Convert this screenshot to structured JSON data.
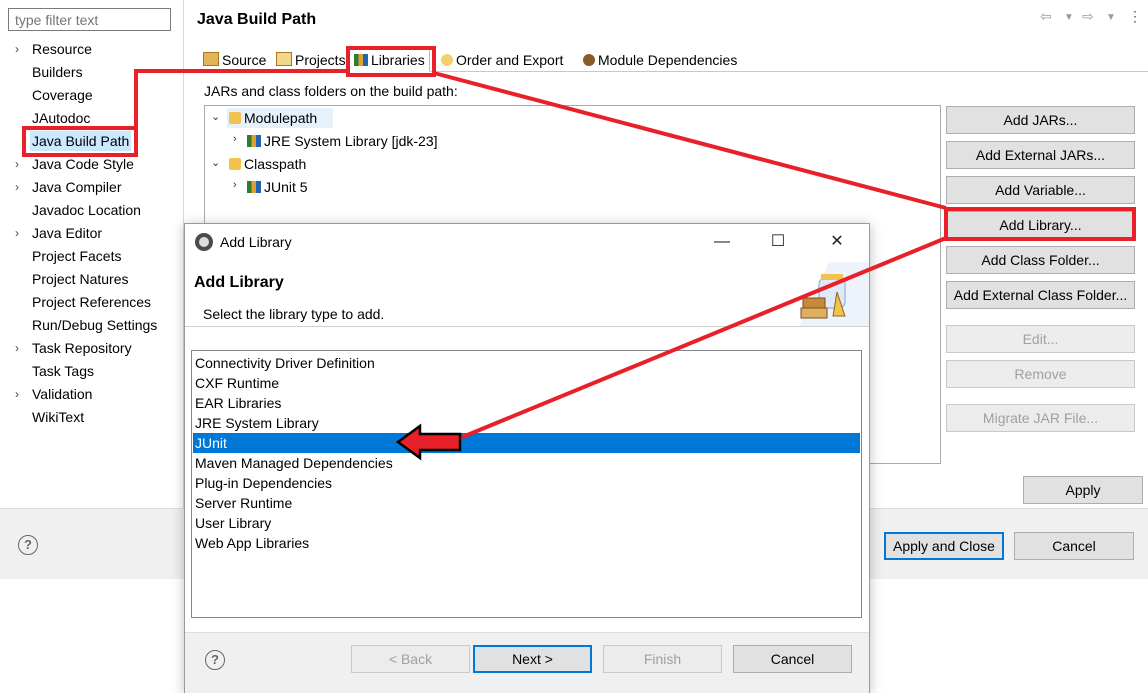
{
  "sidebar": {
    "filter_placeholder": "type filter text",
    "items": [
      {
        "label": "Resource",
        "expandable": true
      },
      {
        "label": "Builders",
        "expandable": false
      },
      {
        "label": "Coverage",
        "expandable": false
      },
      {
        "label": "JAutodoc",
        "expandable": false
      },
      {
        "label": "Java Build Path",
        "expandable": false,
        "selected": true
      },
      {
        "label": "Java Code Style",
        "expandable": true
      },
      {
        "label": "Java Compiler",
        "expandable": true
      },
      {
        "label": "Javadoc Location",
        "expandable": false
      },
      {
        "label": "Java Editor",
        "expandable": true
      },
      {
        "label": "Project Facets",
        "expandable": false
      },
      {
        "label": "Project Natures",
        "expandable": false
      },
      {
        "label": "Project References",
        "expandable": false
      },
      {
        "label": "Run/Debug Settings",
        "expandable": false
      },
      {
        "label": "Task Repository",
        "expandable": true
      },
      {
        "label": "Task Tags",
        "expandable": false
      },
      {
        "label": "Validation",
        "expandable": true
      },
      {
        "label": "WikiText",
        "expandable": false
      }
    ]
  },
  "main": {
    "title": "Java Build Path",
    "tabs": [
      {
        "label": "Source",
        "icon": "source-folder-icon"
      },
      {
        "label": "Projects",
        "icon": "projects-icon"
      },
      {
        "label": "Libraries",
        "icon": "libraries-icon",
        "active": true
      },
      {
        "label": "Order and Export",
        "icon": "order-export-icon"
      },
      {
        "label": "Module Dependencies",
        "icon": "module-icon"
      }
    ],
    "description": "JARs and class folders on the build path:",
    "tree": {
      "modulepath": "Modulepath",
      "jre": "JRE System Library [jdk-23]",
      "classpath": "Classpath",
      "junit": "JUnit 5"
    },
    "buttons": {
      "add_jars": "Add JARs...",
      "add_external_jars": "Add External JARs...",
      "add_variable": "Add Variable...",
      "add_library": "Add Library...",
      "add_class_folder": "Add Class Folder...",
      "add_external_class_folder": "Add External Class Folder...",
      "edit": "Edit...",
      "remove": "Remove",
      "migrate_jar": "Migrate JAR File...",
      "apply": "Apply"
    }
  },
  "footer": {
    "help": "?",
    "apply_and_close": "Apply and Close",
    "cancel": "Cancel"
  },
  "dialog": {
    "window_title": "Add Library",
    "heading": "Add Library",
    "subtitle": "Select the library type to add.",
    "library_types": [
      "Connectivity Driver Definition",
      "CXF Runtime",
      "EAR Libraries",
      "JRE System Library",
      "JUnit",
      "Maven Managed Dependencies",
      "Plug-in Dependencies",
      "Server Runtime",
      "User Library",
      "Web App Libraries"
    ],
    "selected_library": "JUnit",
    "buttons": {
      "back": "< Back",
      "next": "Next >",
      "finish": "Finish",
      "cancel": "Cancel",
      "help": "?"
    }
  },
  "colors": {
    "annotation_red": "#e8202a",
    "selection_blue": "#0078d7",
    "sidebar_selection": "#cce8ff"
  }
}
